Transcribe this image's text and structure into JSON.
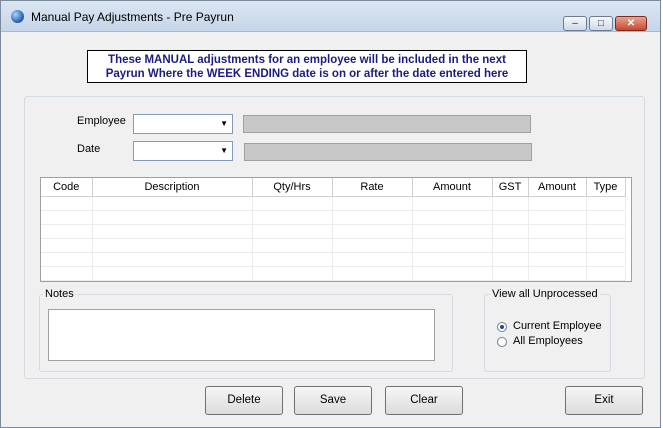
{
  "window": {
    "title": "Manual Pay Adjustments - Pre Payrun",
    "min_glyph": "–",
    "max_glyph": "□",
    "close_glyph": "✕"
  },
  "banner": {
    "line1": "These MANUAL adjustments for an employee will be included in the next",
    "line2": "Payrun Where the WEEK ENDING date is on or after the date entered here"
  },
  "form": {
    "employee_label": "Employee",
    "employee_value": "",
    "date_label": "Date",
    "date_value": ""
  },
  "grid": {
    "columns": [
      "Code",
      "Description",
      "Qty/Hrs",
      "Rate",
      "Amount",
      "GST",
      "Amount",
      "Type"
    ],
    "rows": []
  },
  "notes": {
    "label": "Notes",
    "value": ""
  },
  "view": {
    "label": "View all Unprocessed",
    "options": [
      "Current Employee",
      "All Employees"
    ],
    "selected": "Current Employee"
  },
  "buttons": {
    "delete": "Delete",
    "save": "Save",
    "clear": "Clear",
    "exit": "Exit"
  }
}
